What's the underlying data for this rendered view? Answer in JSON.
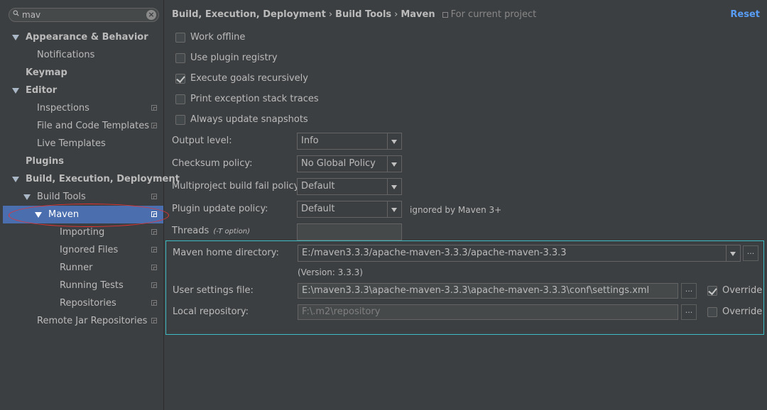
{
  "search": {
    "value": "mav"
  },
  "tree": {
    "appearance": "Appearance & Behavior",
    "notifications": "Notifications",
    "keymap": "Keymap",
    "editor": "Editor",
    "inspections": "Inspections",
    "file_templates": "File and Code Templates",
    "live_templates": "Live Templates",
    "plugins": "Plugins",
    "build": "Build, Execution, Deployment",
    "build_tools": "Build Tools",
    "maven": "Maven",
    "importing": "Importing",
    "ignored_files": "Ignored Files",
    "runner": "Runner",
    "running_tests": "Running Tests",
    "repositories": "Repositories",
    "remote_jar": "Remote Jar Repositories"
  },
  "breadcrumb": {
    "part1": "Build, Execution, Deployment",
    "part2": "Build Tools",
    "part3": "Maven",
    "separator": "›",
    "scope": "For current project"
  },
  "reset": "Reset",
  "checkboxes": {
    "work_offline": {
      "label": "Work offline",
      "checked": false
    },
    "plugin_registry": {
      "label": "Use plugin registry",
      "checked": false
    },
    "execute_goals": {
      "label": "Execute goals recursively",
      "checked": true
    },
    "print_exception": {
      "label": "Print exception stack traces",
      "checked": false
    },
    "always_update": {
      "label": "Always update snapshots",
      "checked": false
    }
  },
  "form": {
    "output_level_label": "Output level:",
    "output_level_value": "Info",
    "checksum_label": "Checksum policy:",
    "checksum_value": "No Global Policy",
    "multiproject_label": "Multiproject build fail policy:",
    "multiproject_value": "Default",
    "plugin_update_label": "Plugin update policy:",
    "plugin_update_value": "Default",
    "plugin_update_hint": "ignored by Maven 3+",
    "threads_label": "Threads",
    "threads_hint": "(-T option)",
    "threads_value": ""
  },
  "maven": {
    "home_label": "Maven home directory:",
    "home_value": "E:/maven3.3.3/apache-maven-3.3.3/apache-maven-3.3.3",
    "version": "(Version: 3.3.3)",
    "settings_label": "User settings file:",
    "settings_value": "E:\\maven3.3.3\\apache-maven-3.3.3\\apache-maven-3.3.3\\conf\\settings.xml",
    "settings_override": "Override",
    "settings_override_checked": true,
    "repo_label": "Local repository:",
    "repo_value": "F:\\.m2\\repository",
    "repo_override": "Override",
    "repo_override_checked": false,
    "browse": "..."
  },
  "colors": {
    "background": "#3c3f41",
    "selection": "#4b6eaf",
    "link": "#589df6",
    "highlight_border": "#3dbcc4",
    "annotation": "#e53333"
  }
}
